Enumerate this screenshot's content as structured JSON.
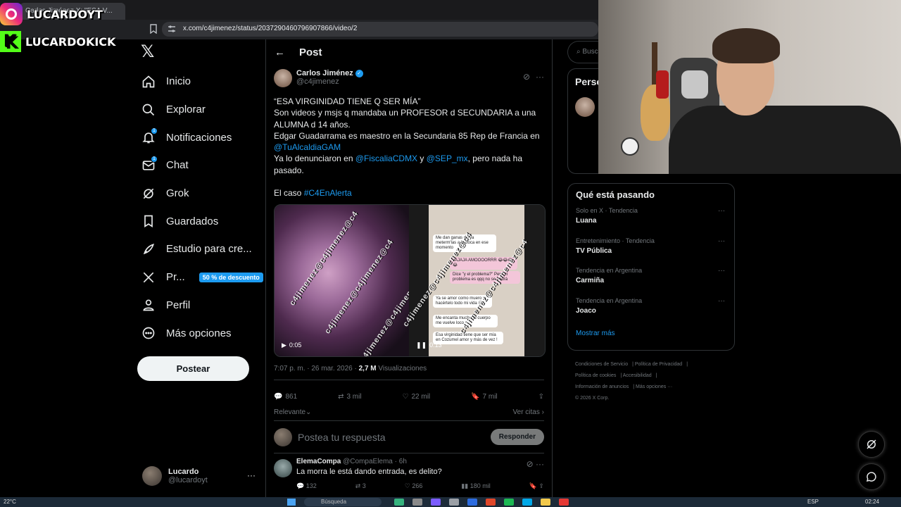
{
  "browser": {
    "tab_title": "Carlos Jiménez X: \"ESA V...",
    "url": "x.com/c4jimenez/status/2037290460796907866/video/2"
  },
  "overlay": {
    "instagram": "LUCARDOYT",
    "kick": "LUCARDOKICK"
  },
  "nav": {
    "items": [
      {
        "label": "Inicio",
        "icon": "home-icon"
      },
      {
        "label": "Explorar",
        "icon": "search-icon"
      },
      {
        "label": "Notificaciones",
        "icon": "bell-icon"
      },
      {
        "label": "Chat",
        "icon": "mail-icon"
      },
      {
        "label": "Grok",
        "icon": "grok-icon"
      },
      {
        "label": "Guardados",
        "icon": "bookmark-icon"
      },
      {
        "label": "Estudio para cre...",
        "icon": "rocket-icon"
      },
      {
        "label": "Pr...",
        "icon": "x-premium-icon"
      },
      {
        "label": "Perfil",
        "icon": "person-icon"
      },
      {
        "label": "Más opciones",
        "icon": "more-circle-icon"
      }
    ],
    "notification_badge": "1",
    "chat_badge": "1",
    "premium_promo": "50 % de descuento",
    "post_button": "Postear"
  },
  "account": {
    "name": "Lucardo",
    "handle": "@lucardoyt",
    "more": "···"
  },
  "main": {
    "header_title": "Post",
    "tweet": {
      "author_name": "Carlos Jiménez",
      "author_handle": "@c4jimenez",
      "line1": "“ESA VIRGINIDAD TIENE Q SER MÍA”",
      "line2": "Son videos y msjs q mandaba un PROFESOR d SECUNDARIA a una ALUMNA d 14 años.",
      "line3": "Edgar Guadarrama es maestro en la Secundaria 85 Rep de Francia en",
      "mention1": "@TuAlcaldiaGAM",
      "line4_pre": "Ya lo denunciaron en ",
      "mention2": "@FiscaliaCDMX",
      "line4_mid": " y ",
      "mention3": "@SEP_mx",
      "line4_post": ", pero nada ha pasado.",
      "case_pre": "El caso ",
      "hashtag": "#C4EnAlerta",
      "video1_time": "0:05",
      "video2_time": "0:13",
      "watermark": "c4jimenez@c4jimenez@c4",
      "chat": [
        "Me dan ganas de ya meterm'las a la boca en ese momento",
        "JAJAJA AMOOOORRR 😂😂😂😂",
        "Dice \"y el problema?\" Pero el problema es qqq no se podrá",
        "Ya se amor como muero x hacértelo todo mi vida 😏",
        "Me encanta mucho tu cuerpo me vuelve loco",
        "Esa virginidad tiene que ser mía en Cozumel amor y más de vez !"
      ],
      "time": "7:07 p. m. · 26 mar. 2026 · ",
      "views_count": "2,7 M",
      "views_label": " Visualizaciones",
      "replies": "861",
      "reposts": "3 mil",
      "likes": "22 mil",
      "bookmarks": "7 mil",
      "sort_label": "Relevante",
      "quotes_label": "Ver citas"
    },
    "reply_placeholder": "Postea tu respuesta",
    "reply_button": "Responder",
    "reply": {
      "name": "ElemaCompa",
      "handle": "@CompaElema · 6h",
      "text": "La morra le está dando entrada, es delito?",
      "replies": "132",
      "reposts": "3",
      "likes": "266",
      "views": "180 mil"
    }
  },
  "sidebar": {
    "search_placeholder": "Busca",
    "persona_title": "Perso",
    "trends_title": "Qué está pasando",
    "trends": [
      {
        "category": "Solo en X · Tendencia",
        "title": "Luana"
      },
      {
        "category": "Entretenimiento · Tendencia",
        "title": "TV Pública"
      },
      {
        "category": "Tendencia en Argentina",
        "title": "Carmiña"
      },
      {
        "category": "Tendencia en Argentina",
        "title": "Joaco"
      }
    ],
    "show_more": "Mostrar más",
    "footer": [
      "Condiciones de Servicio",
      "Política de Privacidad",
      "Política de cookies",
      "Accesibilidad",
      "Información de anuncios",
      "Más opciones ···",
      "© 2026 X Corp."
    ]
  },
  "taskbar": {
    "weather": "22°C",
    "search": "Búsqueda",
    "lang": "ESP",
    "clock": "02:24"
  }
}
